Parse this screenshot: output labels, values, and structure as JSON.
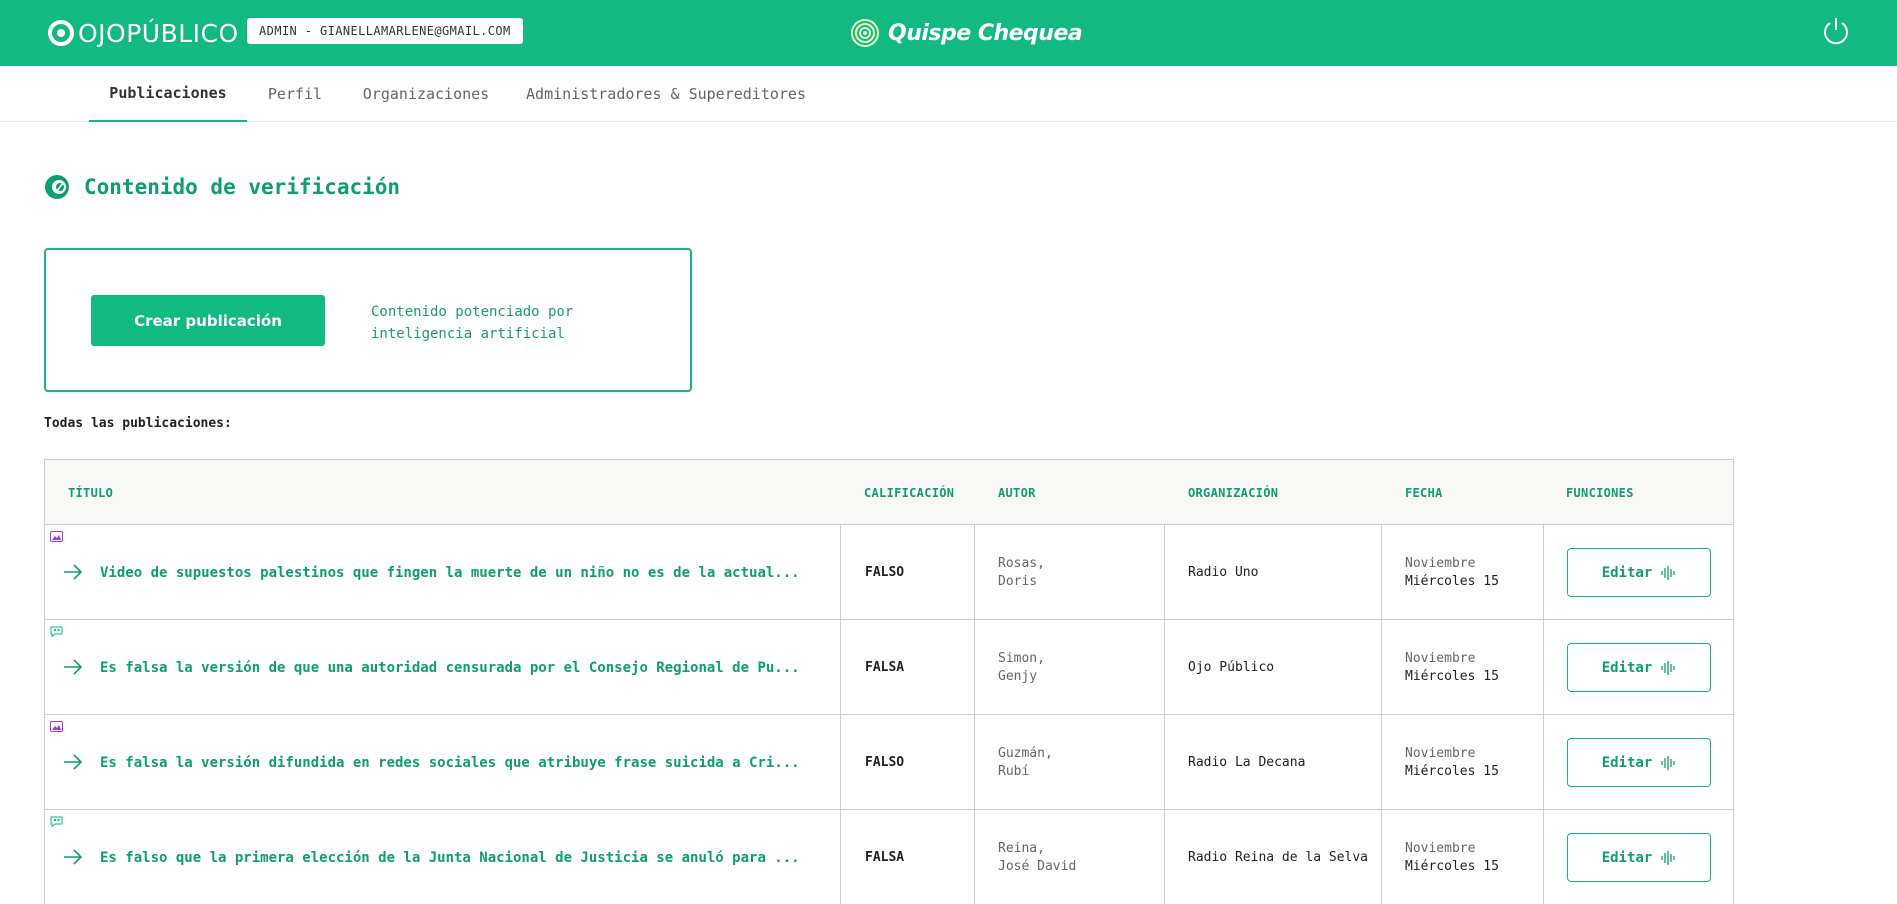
{
  "header": {
    "brand": "OJOPÚBLICO",
    "admin_badge": "ADMIN - GIANELLAMARLENE@GMAIL.COM",
    "center_brand": "Quispe Chequea"
  },
  "nav": {
    "tabs": [
      {
        "label": "Publicaciones",
        "active": true
      },
      {
        "label": "Perfil",
        "active": false
      },
      {
        "label": "Organizaciones",
        "active": false
      },
      {
        "label": "Administradores & Supereditores",
        "active": false
      }
    ]
  },
  "section": {
    "title": "Contenido de verificación"
  },
  "create": {
    "button_label": "Crear publicación",
    "note": "Contenido potenciado por inteligencia artificial"
  },
  "list_label": "Todas las publicaciones:",
  "table": {
    "headers": [
      "TÍTULO",
      "CALIFICACIÓN",
      "AUTOR",
      "ORGANIZACIÓN",
      "FECHA",
      "FUNCIONES"
    ],
    "edit_label": "Editar",
    "rows": [
      {
        "type_icon": "image-icon",
        "title": "Video de supuestos palestinos que fingen la muerte de un niño no es de la actual...",
        "rating": "FALSO",
        "author_last": "Rosas,",
        "author_first": "Doris",
        "organization": "Radio Uno",
        "month": "Noviembre",
        "day": "Miércoles 15"
      },
      {
        "type_icon": "quote-icon",
        "title": "Es falsa la versión de que una autoridad censurada por el Consejo Regional de Pu...",
        "rating": "FALSA",
        "author_last": "Simon,",
        "author_first": "Genjy",
        "organization": "Ojo Público",
        "month": "Noviembre",
        "day": "Miércoles 15"
      },
      {
        "type_icon": "image-icon",
        "title": "Es falsa la versión difundida en redes sociales que atribuye frase suicida a Cri...",
        "rating": "FALSO",
        "author_last": "Guzmán,",
        "author_first": "Rubí",
        "organization": "Radio La Decana",
        "month": "Noviembre",
        "day": "Miércoles 15"
      },
      {
        "type_icon": "quote-icon",
        "title": "Es falso que la primera elección de la Junta Nacional de Justicia se anuló para ...",
        "rating": "FALSA",
        "author_last": "Reina,",
        "author_first": "José David",
        "organization": "Radio Reina de la Selva",
        "month": "Noviembre",
        "day": "Miércoles 15"
      }
    ]
  },
  "colors": {
    "brand_green": "#12b981",
    "text_green": "#0f9e6e",
    "image_icon_purple": "#9b3dd6",
    "quote_icon_green": "#12b981"
  }
}
